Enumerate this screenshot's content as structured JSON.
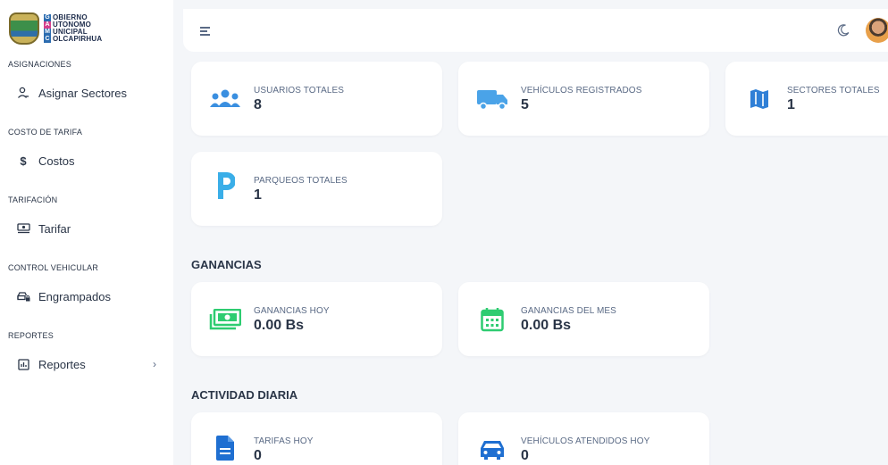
{
  "logo": {
    "letters": [
      "G",
      "A",
      "M",
      "C"
    ],
    "words": [
      "OBIERNO",
      "UTONOMO",
      "UNICIPAL",
      "OLCAPIRHUA"
    ],
    "letter_colors": [
      "#2b6cb0",
      "#d53f8c",
      "#2b6cb0",
      "#2b6cb0"
    ]
  },
  "sidebar": {
    "sections": [
      {
        "title": "ASIGNACIONES",
        "item": {
          "label": "Asignar Sectores",
          "icon": "user-icon"
        }
      },
      {
        "title": "COSTO DE TARIFA",
        "item": {
          "label": "Costos",
          "icon": "dollar-icon"
        }
      },
      {
        "title": "TARIFACIÓN",
        "item": {
          "label": "Tarifar",
          "icon": "cash-icon"
        }
      },
      {
        "title": "CONTROL VEHICULAR",
        "item": {
          "label": "Engrampados",
          "icon": "car-lock-icon"
        }
      },
      {
        "title": "REPORTES",
        "item": {
          "label": "Reportes",
          "icon": "chart-icon",
          "arrow": "›"
        }
      }
    ]
  },
  "stats": [
    {
      "label": "USUARIOS TOTALES",
      "value": "8",
      "icon": "users-icon",
      "color": "#3a8fe0"
    },
    {
      "label": "VEHÍCULOS REGISTRADOS",
      "value": "5",
      "icon": "truck-icon",
      "color": "#4aa3e8"
    },
    {
      "label": "SECTORES TOTALES",
      "value": "1",
      "icon": "map-icon",
      "color": "#2f7fd6"
    },
    {
      "label": "PARQUEOS TOTALES",
      "value": "1",
      "icon": "parking-icon",
      "color": "#3aaee8"
    }
  ],
  "ganancias": {
    "heading": "GANANCIAS",
    "cards": [
      {
        "label": "GANANCIAS HOY",
        "value": "0.00 Bs",
        "icon": "money-icon",
        "color": "#2ecc71"
      },
      {
        "label": "GANANCIAS DEL MES",
        "value": "0.00 Bs",
        "icon": "calendar-icon",
        "color": "#2ecc71"
      }
    ]
  },
  "actividad": {
    "heading": "ACTIVIDAD DIARIA",
    "cards": [
      {
        "label": "TARIFAS HOY",
        "value": "0",
        "icon": "document-icon",
        "color": "#1f6fd1"
      },
      {
        "label": "VEHÍCULOS ATENDIDOS HOY",
        "value": "0",
        "icon": "car-icon",
        "color": "#1f6fd1"
      }
    ]
  }
}
